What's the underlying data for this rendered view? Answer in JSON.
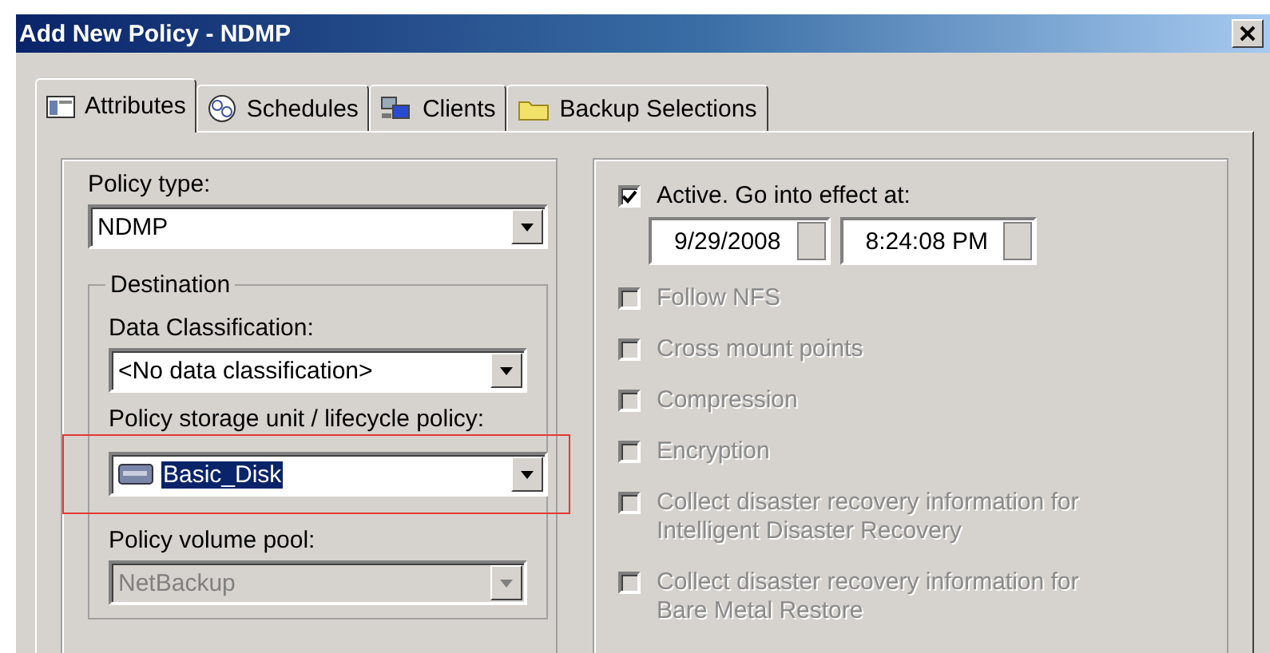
{
  "window": {
    "title": "Add New Policy - NDMP"
  },
  "tabs": [
    {
      "label": "Attributes",
      "selected": true,
      "kind": "list"
    },
    {
      "label": "Schedules",
      "selected": false,
      "kind": "clock"
    },
    {
      "label": "Clients",
      "selected": false,
      "kind": "computers"
    },
    {
      "label": "Backup Selections",
      "selected": false,
      "kind": "folder"
    }
  ],
  "policy_type": {
    "label": "Policy type:",
    "value": "NDMP"
  },
  "destination": {
    "legend": "Destination",
    "fields": [
      {
        "label": "Data Classification:",
        "value": "<No data classification>",
        "kind": "plain",
        "disabled": false,
        "text_selected": false,
        "highlighted": false
      },
      {
        "label": "Policy storage unit / lifecycle policy:",
        "value": "Basic_Disk",
        "kind": "disk",
        "disabled": false,
        "text_selected": true,
        "highlighted": true
      },
      {
        "label": "Policy volume pool:",
        "value": "NetBackup",
        "kind": "plain",
        "disabled": true,
        "text_selected": false,
        "highlighted": false
      }
    ]
  },
  "active": {
    "label": "Active. Go into effect at:",
    "checked": true,
    "date": "9/29/2008",
    "time": "8:24:08 PM"
  },
  "options": [
    {
      "label": "Follow NFS",
      "checked": false,
      "disabled": true
    },
    {
      "label": "Cross mount points",
      "checked": false,
      "disabled": true
    },
    {
      "label": "Compression",
      "checked": false,
      "disabled": true
    },
    {
      "label": "Encryption",
      "checked": false,
      "disabled": true
    },
    {
      "label": "Collect disaster recovery information for Intelligent Disaster Recovery",
      "checked": false,
      "disabled": true
    },
    {
      "label": "Collect disaster recovery information for Bare Metal Restore",
      "checked": false,
      "disabled": true
    }
  ]
}
